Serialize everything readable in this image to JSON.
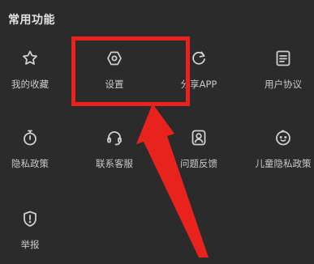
{
  "section": {
    "title": "常用功能"
  },
  "items": [
    {
      "label": "我的收藏",
      "icon": "star-icon"
    },
    {
      "label": "设置",
      "icon": "settings-hexagon-icon"
    },
    {
      "label": "分享APP",
      "icon": "share-refresh-icon"
    },
    {
      "label": "用户协议",
      "icon": "document-icon"
    },
    {
      "label": "隐私政策",
      "icon": "stopwatch-icon"
    },
    {
      "label": "联系客服",
      "icon": "headset-icon"
    },
    {
      "label": "问题反馈",
      "icon": "user-card-icon"
    },
    {
      "label": "儿童隐私政策",
      "icon": "child-face-icon"
    },
    {
      "label": "举报",
      "icon": "shield-alert-icon"
    }
  ],
  "colors": {
    "background": "#2b2b2b",
    "annotation": "#e8221c",
    "text": "#c9c9c9"
  }
}
